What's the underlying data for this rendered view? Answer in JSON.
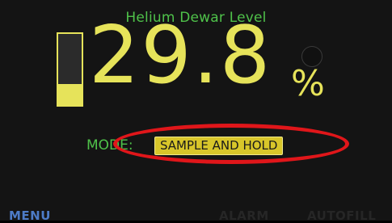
{
  "title": "Helium Dewar Level",
  "level": {
    "value": "29.8",
    "unit": "%",
    "fill_fraction": 0.298
  },
  "mode": {
    "label": "MODE:",
    "value": "SAMPLE AND HOLD"
  },
  "footer": {
    "menu": "MENU",
    "alarm": "ALARM",
    "autofill": "AUTOFILL"
  },
  "colors": {
    "accent_yellow": "#e6e35a",
    "label_green": "#4fc24a",
    "menu_blue": "#4d7bc6",
    "highlight_red": "#e0161a"
  }
}
